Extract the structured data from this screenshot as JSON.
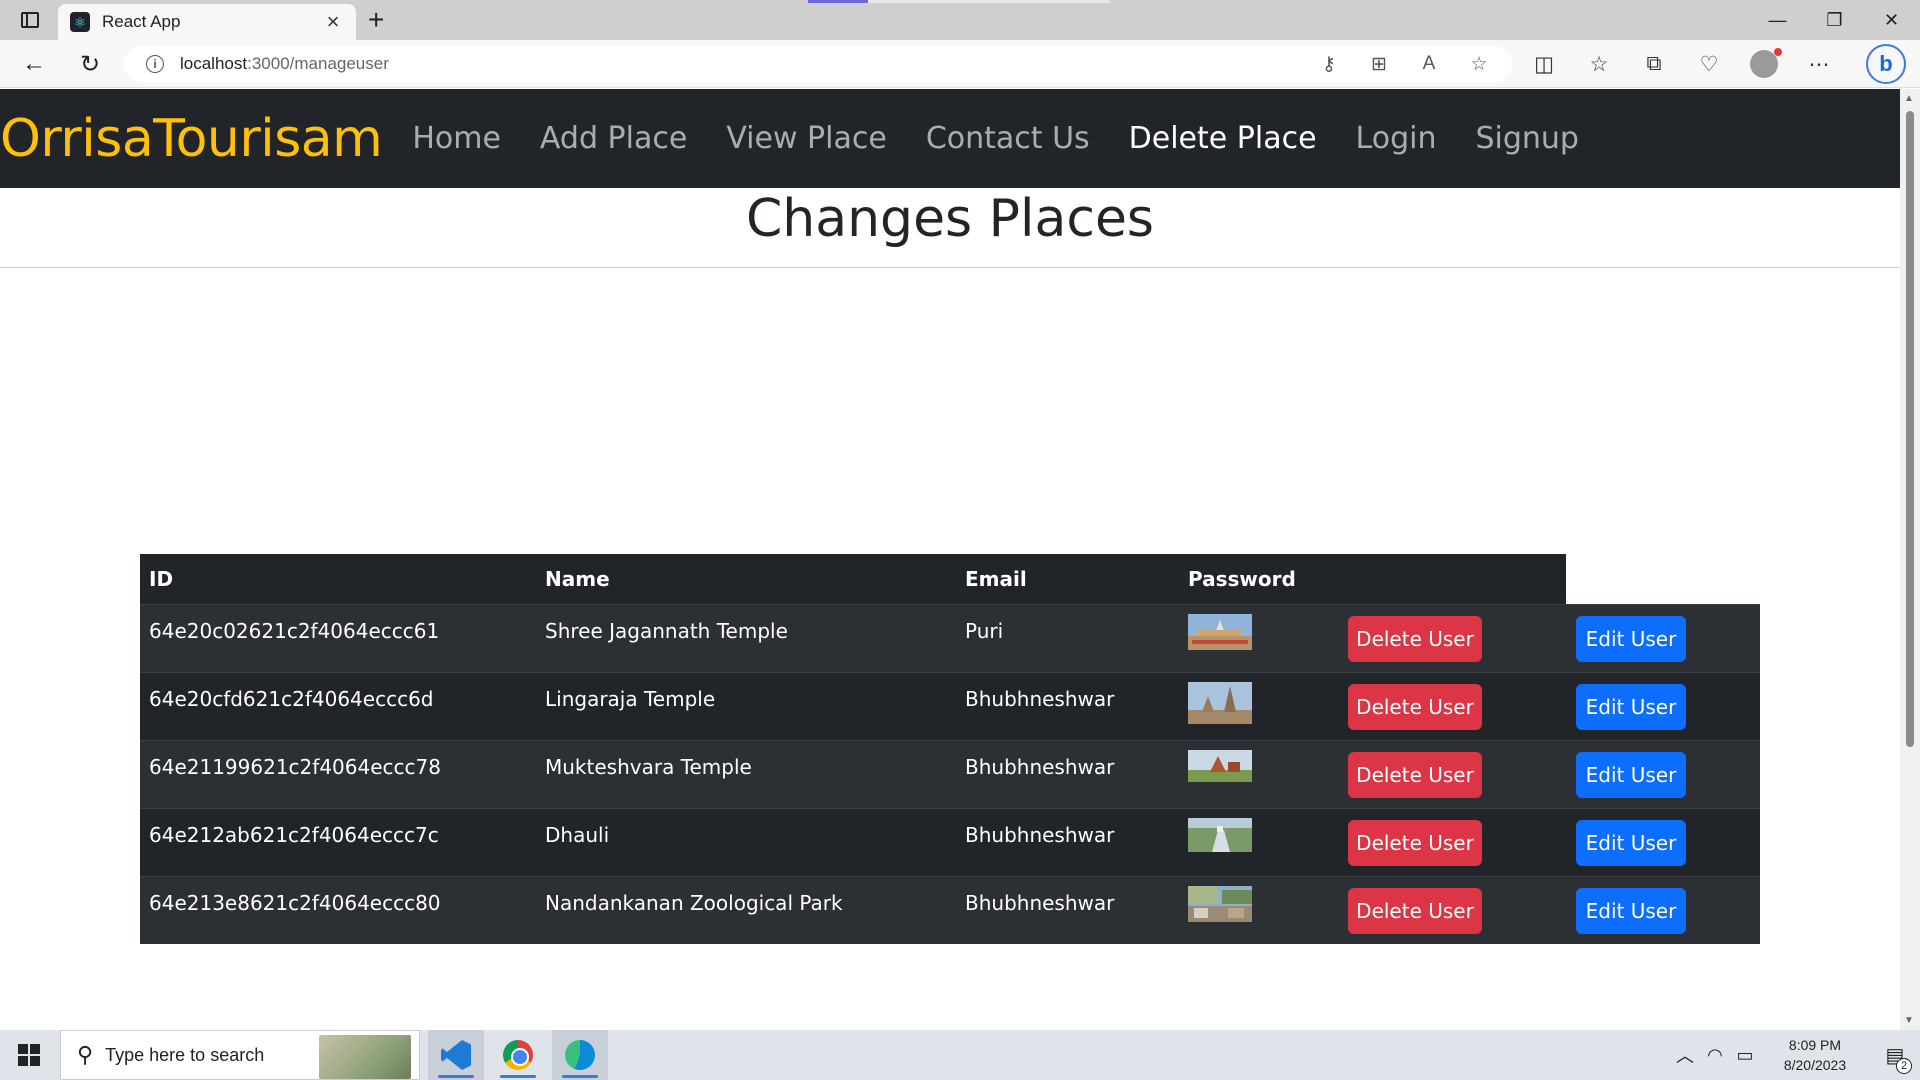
{
  "browser": {
    "tab_title": "React App",
    "url_host": "localhost",
    "url_path": ":3000/manageuser"
  },
  "navbar": {
    "brand": "OrrisaTourisam",
    "links": [
      "Home",
      "Add Place",
      "View Place",
      "Contact Us",
      "Delete Place",
      "Login",
      "Signup"
    ],
    "active_link": "Delete Place"
  },
  "page": {
    "title": "Changes Places"
  },
  "table": {
    "headers": [
      "ID",
      "Name",
      "Email",
      "Password"
    ],
    "rows": [
      {
        "id": "64e20c02621c2f4064eccc61",
        "name": "Shree Jagannath Temple",
        "email": "Puri",
        "thumb": "temple-image",
        "delete_label": "Delete User",
        "edit_label": "Edit User"
      },
      {
        "id": "64e20cfd621c2f4064eccc6d",
        "name": "Lingaraja Temple",
        "email": "Bhubhneshwar",
        "thumb": "temple-image",
        "delete_label": "Delete User",
        "edit_label": "Edit User"
      },
      {
        "id": "64e21199621c2f4064eccc78",
        "name": "Mukteshvara Temple",
        "email": "Bhubhneshwar",
        "thumb": "temple-image",
        "delete_label": "Delete User",
        "edit_label": "Edit User"
      },
      {
        "id": "64e212ab621c2f4064eccc7c",
        "name": "Dhauli",
        "email": "Bhubhneshwar",
        "thumb": "landscape-image",
        "delete_label": "Delete User",
        "edit_label": "Edit User"
      },
      {
        "id": "64e213e8621c2f4064eccc80",
        "name": "Nandankanan Zoological Park",
        "email": "Bhubhneshwar",
        "thumb": "park-image",
        "delete_label": "Delete User",
        "edit_label": "Edit User"
      }
    ]
  },
  "colors": {
    "brand": "#ffc107",
    "navbar_bg": "#212529",
    "danger": "#dc3545",
    "primary": "#0d6efd"
  },
  "taskbar": {
    "search_placeholder": "Type here to search",
    "time": "8:09 PM",
    "date": "8/20/2023",
    "notification_count": "2"
  }
}
